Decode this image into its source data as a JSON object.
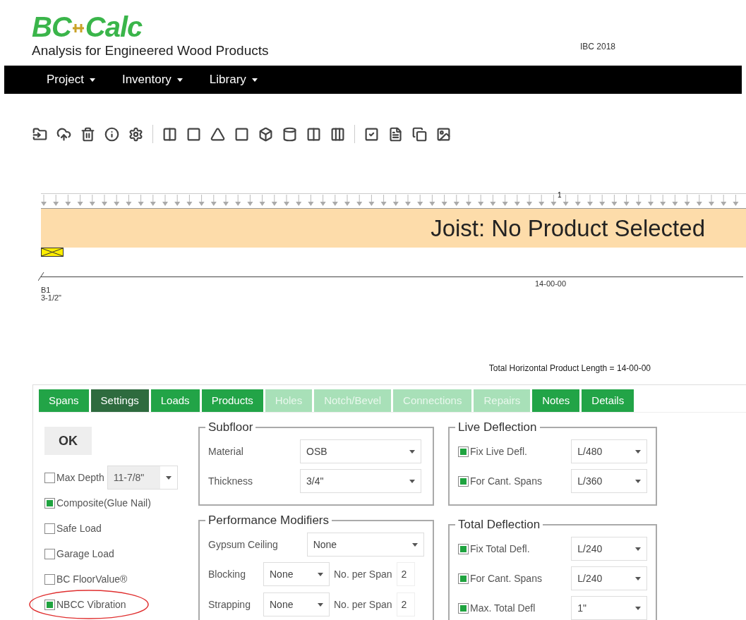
{
  "header": {
    "logo": [
      "BC",
      "Calc"
    ],
    "tagline": "Analysis for Engineered Wood Products",
    "code": "IBC 2018"
  },
  "menu": [
    {
      "label": "Project"
    },
    {
      "label": "Inventory"
    },
    {
      "label": "Library"
    }
  ],
  "diagram": {
    "load_label": "1",
    "beam_label": "Joist: No Product Selected",
    "span_label": "14-00-00",
    "support_name": "B1",
    "support_width": "3-1/2\""
  },
  "total_length": "Total Horizontal Product Length = 14-00-00",
  "tabs": [
    {
      "label": "Spans",
      "selected": false,
      "disabled": false
    },
    {
      "label": "Settings",
      "selected": true,
      "disabled": false
    },
    {
      "label": "Loads",
      "selected": false,
      "disabled": false
    },
    {
      "label": "Products",
      "selected": false,
      "disabled": false
    },
    {
      "label": "Holes",
      "selected": false,
      "disabled": true
    },
    {
      "label": "Notch/Bevel",
      "selected": false,
      "disabled": true
    },
    {
      "label": "Connections",
      "selected": false,
      "disabled": true
    },
    {
      "label": "Repairs",
      "selected": false,
      "disabled": true
    },
    {
      "label": "Notes",
      "selected": false,
      "disabled": false
    },
    {
      "label": "Details",
      "selected": false,
      "disabled": false
    }
  ],
  "settings": {
    "ok_button": "OK",
    "max_depth": {
      "label": "Max Depth",
      "checked": false,
      "value": "11-7/8\""
    },
    "options": [
      {
        "label": "Composite(Glue Nail)",
        "checked": true,
        "circled": false
      },
      {
        "label": "Safe Load",
        "checked": false,
        "circled": false
      },
      {
        "label": "Garage Load",
        "checked": false,
        "circled": false
      },
      {
        "label": "BC FloorValue®",
        "checked": false,
        "circled": false
      },
      {
        "label": "NBCC Vibration",
        "checked": true,
        "circled": true
      }
    ]
  },
  "subfloor": {
    "title": "Subfloor",
    "fields": [
      {
        "label": "Material",
        "value": "OSB"
      },
      {
        "label": "Thickness",
        "value": "3/4\""
      }
    ]
  },
  "performance": {
    "title": "Performance Modifiers",
    "gypsum": {
      "label": "Gypsum Ceiling",
      "value": "None"
    },
    "rows": [
      {
        "label": "Blocking",
        "value": "None",
        "count_label": "No. per Span",
        "count": "2"
      },
      {
        "label": "Strapping",
        "value": "None",
        "count_label": "No. per Span",
        "count": "2"
      }
    ]
  },
  "live_deflection": {
    "title": "Live Deflection",
    "rows": [
      {
        "label": "Fix Live Defl.",
        "checked": true,
        "value": "L/480"
      },
      {
        "label": "For Cant. Spans",
        "checked": true,
        "value": "L/360"
      }
    ]
  },
  "total_deflection": {
    "title": "Total Deflection",
    "rows": [
      {
        "label": "Fix Total Defl.",
        "checked": true,
        "value": "L/240"
      },
      {
        "label": "For Cant. Spans",
        "checked": true,
        "value": "L/240"
      },
      {
        "label": "Max. Total Defl",
        "checked": true,
        "value": "1\""
      }
    ]
  }
}
